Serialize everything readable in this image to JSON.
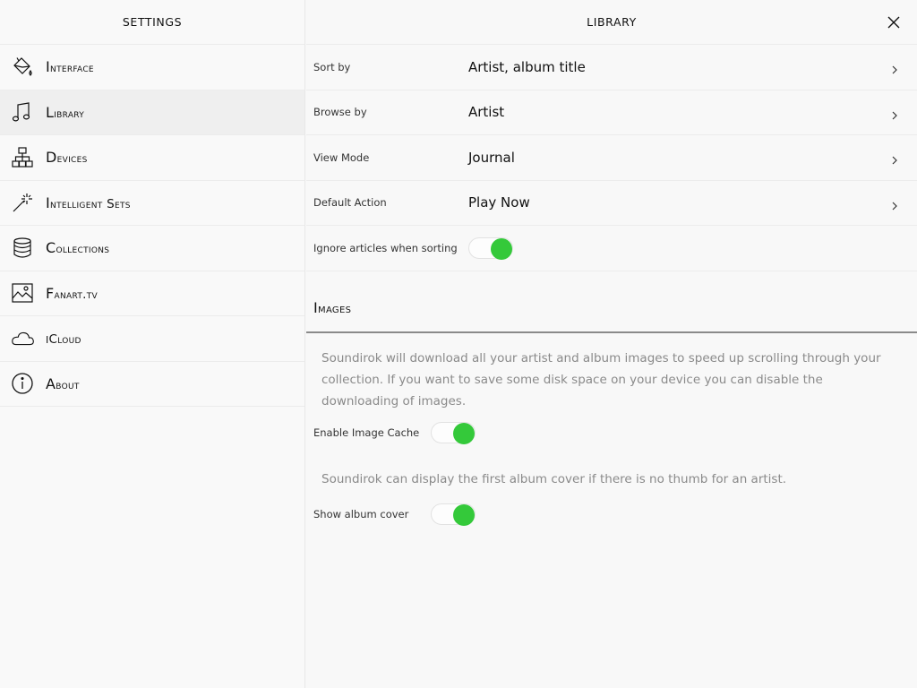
{
  "sidebar": {
    "title": "Settings",
    "items": [
      {
        "label": "Interface",
        "icon": "paint-bucket-icon",
        "active": false
      },
      {
        "label": "Library",
        "icon": "music-note-icon",
        "active": true
      },
      {
        "label": "Devices",
        "icon": "network-icon",
        "active": false
      },
      {
        "label": "Intelligent Sets",
        "icon": "magic-wand-icon",
        "active": false
      },
      {
        "label": "Collections",
        "icon": "database-icon",
        "active": false
      },
      {
        "label": "Fanart.tv",
        "icon": "image-icon",
        "active": false
      },
      {
        "label": "iCloud",
        "icon": "cloud-icon",
        "active": false
      },
      {
        "label": "About",
        "icon": "info-icon",
        "active": false
      }
    ]
  },
  "main": {
    "title": "LIBRARY",
    "rows": [
      {
        "label": "Sort by",
        "value": "Artist, album title"
      },
      {
        "label": "Browse by",
        "value": "Artist"
      },
      {
        "label": "View Mode",
        "value": "Journal"
      },
      {
        "label": "Default Action",
        "value": "Play Now"
      }
    ],
    "ignore_articles": {
      "label": "Ignore articles when sorting",
      "on": true
    },
    "images": {
      "heading": "Images",
      "desc1": "Soundirok will download all your artist and album images to speed up scrolling through your collection. If you want to save some disk space on your device you can disable the downloading of images.",
      "image_cache": {
        "label": "Enable Image Cache",
        "on": true
      },
      "desc2": "Soundirok can display the first album cover if there is no thumb for an artist.",
      "album_cover": {
        "label": "Show album cover",
        "on": true
      }
    }
  },
  "colors": {
    "toggle_on": "#34c93a",
    "text": "#111111",
    "muted": "#8a8a8a"
  }
}
